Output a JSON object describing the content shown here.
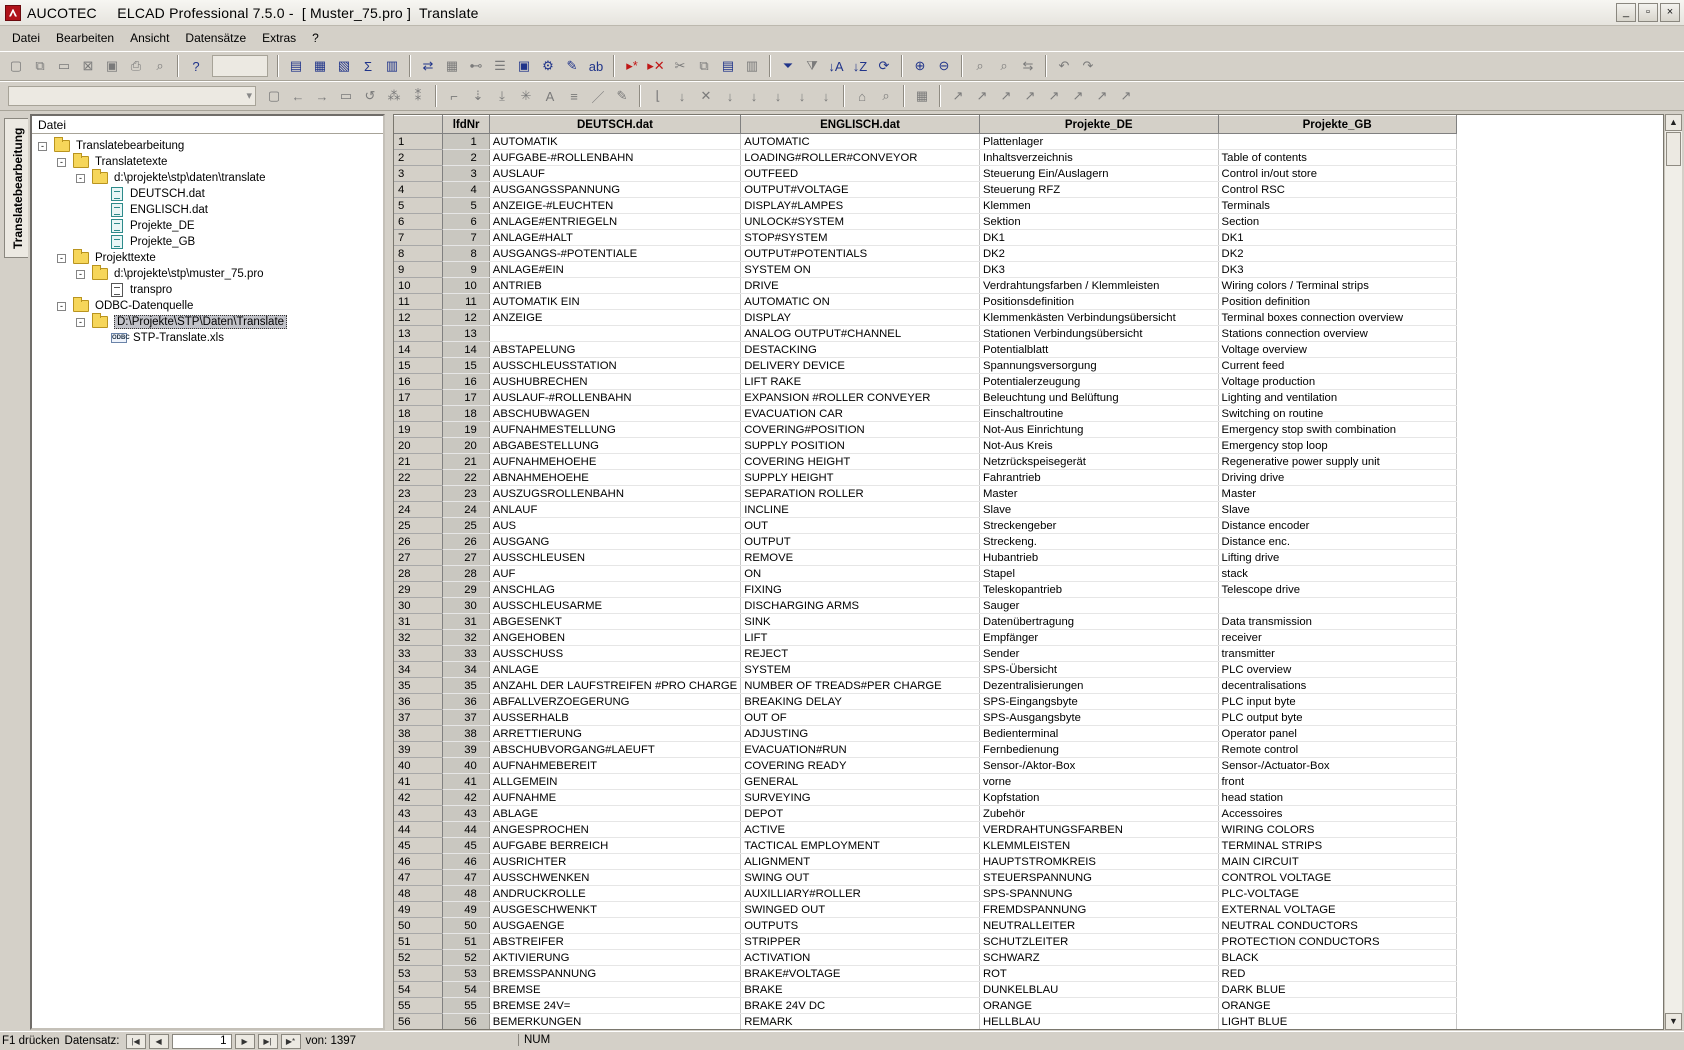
{
  "window": {
    "title": "AUCOTEC     ELCAD Professional 7.5.0 -  [ Muster_75.pro ]  Translate",
    "controls": [
      "_",
      "▫",
      "×"
    ]
  },
  "menu": [
    "Datei",
    "Bearbeiten",
    "Ansicht",
    "Datensätze",
    "Extras",
    "?"
  ],
  "side_tab": "Translatebearbeitung",
  "tree": {
    "header": "Datei",
    "nodes": [
      {
        "label": "Translatebearbeitung",
        "level": 0,
        "icon": "folder-icon",
        "expander": "-"
      },
      {
        "label": "Translatetexte",
        "level": 1,
        "icon": "folder-icon",
        "expander": "-"
      },
      {
        "label": "d:\\projekte\\stp\\daten\\translate",
        "level": 2,
        "icon": "folder-icon",
        "expander": "-"
      },
      {
        "label": "DEUTSCH.dat",
        "level": 3,
        "icon": "file-icon"
      },
      {
        "label": "ENGLISCH.dat",
        "level": 3,
        "icon": "file-icon"
      },
      {
        "label": "Projekte_DE",
        "level": 3,
        "icon": "file-icon"
      },
      {
        "label": "Projekte_GB",
        "level": 3,
        "icon": "file-icon"
      },
      {
        "label": "Projekttexte",
        "level": 1,
        "icon": "folder-icon",
        "expander": "-"
      },
      {
        "label": "d:\\projekte\\stp\\muster_75.pro",
        "level": 2,
        "icon": "folder-icon",
        "expander": "-"
      },
      {
        "label": "transpro",
        "level": 3,
        "icon": "doc-icon"
      },
      {
        "label": "ODBC-Datenquelle",
        "level": 1,
        "icon": "folder-icon",
        "expander": "-"
      },
      {
        "label": "D:\\Projekte\\STP\\Daten\\Translate",
        "level": 2,
        "icon": "folder-icon",
        "expander": "-",
        "selected": true
      },
      {
        "label": "STP-Translate.xls",
        "level": 3,
        "icon": "odbc-icon",
        "icon_text": "ODBC"
      }
    ]
  },
  "grid": {
    "columns": [
      "lfdNr",
      "DEUTSCH.dat",
      "ENGLISCH.dat",
      "Projekte_DE",
      "Projekte_GB"
    ],
    "rows": [
      [
        "1",
        "1",
        "AUTOMATIK",
        "AUTOMATIC",
        "Plattenlager",
        ""
      ],
      [
        "2",
        "2",
        "AUFGABE-#ROLLENBAHN",
        "LOADING#ROLLER#CONVEYOR",
        "Inhaltsverzeichnis",
        "Table of contents"
      ],
      [
        "3",
        "3",
        "AUSLAUF",
        "OUTFEED",
        "Steuerung Ein/Auslagern",
        "Control in/out store"
      ],
      [
        "4",
        "4",
        "AUSGANGSSPANNUNG",
        "OUTPUT#VOLTAGE",
        "Steuerung RFZ",
        "Control RSC"
      ],
      [
        "5",
        "5",
        "ANZEIGE-#LEUCHTEN",
        "DISPLAY#LAMPES",
        "Klemmen",
        "Terminals"
      ],
      [
        "6",
        "6",
        "ANLAGE#ENTRIEGELN",
        "UNLOCK#SYSTEM",
        "Sektion",
        "Section"
      ],
      [
        "7",
        "7",
        "ANLAGE#HALT",
        "STOP#SYSTEM",
        "DK1",
        "DK1"
      ],
      [
        "8",
        "8",
        "AUSGANGS-#POTENTIALE",
        "OUTPUT#POTENTIALS",
        "DK2",
        "DK2"
      ],
      [
        "9",
        "9",
        "ANLAGE#EIN",
        "SYSTEM ON",
        "DK3",
        "DK3"
      ],
      [
        "10",
        "10",
        "ANTRIEB",
        "DRIVE",
        "Verdrahtungsfarben / Klemmleisten",
        "Wiring colors / Terminal strips"
      ],
      [
        "11",
        "11",
        "AUTOMATIK EIN",
        "AUTOMATIC ON",
        "Positionsdefinition",
        "Position definition"
      ],
      [
        "12",
        "12",
        "ANZEIGE",
        "DISPLAY",
        "Klemmenkästen Verbindungsübersicht",
        "Terminal boxes connection overview"
      ],
      [
        "13",
        "13",
        "",
        "ANALOG OUTPUT#CHANNEL",
        "Stationen Verbindungsübersicht",
        "Stations connection overview"
      ],
      [
        "14",
        "14",
        "ABSTAPELUNG",
        "DESTACKING",
        "Potentialblatt",
        "Voltage overview"
      ],
      [
        "15",
        "15",
        "AUSSCHLEUSSTATION",
        "DELIVERY DEVICE",
        "Spannungsversorgung",
        "Current feed"
      ],
      [
        "16",
        "16",
        "AUSHUBRECHEN",
        "LIFT RAKE",
        "Potentialerzeugung",
        "Voltage production"
      ],
      [
        "17",
        "17",
        "AUSLAUF-#ROLLENBAHN",
        "EXPANSION #ROLLER CONVEYER",
        "Beleuchtung und Belüftung",
        "Lighting and ventilation"
      ],
      [
        "18",
        "18",
        "ABSCHUBWAGEN",
        "EVACUATION CAR",
        "Einschaltroutine",
        "Switching on routine"
      ],
      [
        "19",
        "19",
        "AUFNAHMESTELLUNG",
        "COVERING#POSITION",
        "Not-Aus Einrichtung",
        "Emergency stop swith combination"
      ],
      [
        "20",
        "20",
        "ABGABESTELLUNG",
        "SUPPLY POSITION",
        "Not-Aus Kreis",
        "Emergency stop loop"
      ],
      [
        "21",
        "21",
        "AUFNAHMEHOEHE",
        "COVERING HEIGHT",
        "Netzrückspeisegerät",
        "Regenerative power supply unit"
      ],
      [
        "22",
        "22",
        "ABNAHMEHOEHE",
        "SUPPLY HEIGHT",
        "Fahrantrieb",
        "Driving drive"
      ],
      [
        "23",
        "23",
        "AUSZUGSROLLENBAHN",
        "SEPARATION ROLLER",
        "Master",
        "Master"
      ],
      [
        "24",
        "24",
        "ANLAUF",
        "INCLINE",
        "Slave",
        "Slave"
      ],
      [
        "25",
        "25",
        "AUS",
        "OUT",
        "Streckengeber",
        "Distance encoder"
      ],
      [
        "26",
        "26",
        "AUSGANG",
        "OUTPUT",
        "Streckeng.",
        "Distance enc."
      ],
      [
        "27",
        "27",
        "AUSSCHLEUSEN",
        "REMOVE",
        "Hubantrieb",
        "Lifting drive"
      ],
      [
        "28",
        "28",
        "AUF",
        "ON",
        "Stapel",
        "stack"
      ],
      [
        "29",
        "29",
        "ANSCHLAG",
        "FIXING",
        "Teleskopantrieb",
        "Telescope drive"
      ],
      [
        "30",
        "30",
        "AUSSCHLEUSARME",
        "DISCHARGING ARMS",
        "Sauger",
        ""
      ],
      [
        "31",
        "31",
        "ABGESENKT",
        "SINK",
        "Datenübertragung",
        "Data transmission"
      ],
      [
        "32",
        "32",
        "ANGEHOBEN",
        "LIFT",
        "Empfänger",
        "receiver"
      ],
      [
        "33",
        "33",
        "AUSSCHUSS",
        "REJECT",
        "Sender",
        "transmitter"
      ],
      [
        "34",
        "34",
        "ANLAGE",
        "SYSTEM",
        "SPS-Übersicht",
        "PLC overview"
      ],
      [
        "35",
        "35",
        "ANZAHL DER LAUFSTREIFEN #PRO CHARGE",
        "NUMBER OF TREADS#PER CHARGE",
        "Dezentralisierungen",
        "decentralisations"
      ],
      [
        "36",
        "36",
        "ABFALLVERZOEGERUNG",
        "BREAKING DELAY",
        "SPS-Eingangsbyte",
        "PLC input byte"
      ],
      [
        "37",
        "37",
        "AUSSERHALB",
        "OUT OF",
        "SPS-Ausgangsbyte",
        "PLC output byte"
      ],
      [
        "38",
        "38",
        "ARRETTIERUNG",
        "ADJUSTING",
        "Bedienterminal",
        "Operator panel"
      ],
      [
        "39",
        "39",
        "ABSCHUBVORGANG#LAEUFT",
        "EVACUATION#RUN",
        "Fernbedienung",
        "Remote control"
      ],
      [
        "40",
        "40",
        "AUFNAHMEBEREIT",
        "COVERING READY",
        "Sensor-/Aktor-Box",
        "Sensor-/Actuator-Box"
      ],
      [
        "41",
        "41",
        "ALLGEMEIN",
        "GENERAL",
        "vorne",
        "front"
      ],
      [
        "42",
        "42",
        "AUFNAHME",
        "SURVEYING",
        "Kopfstation",
        "head station"
      ],
      [
        "43",
        "43",
        "ABLAGE",
        "DEPOT",
        "Zubehör",
        "Accessoires"
      ],
      [
        "44",
        "44",
        "ANGESPROCHEN",
        "ACTIVE",
        "VERDRAHTUNGSFARBEN",
        "WIRING COLORS"
      ],
      [
        "45",
        "45",
        "AUFGABE BERREICH",
        "TACTICAL EMPLOYMENT",
        "KLEMMLEISTEN",
        "TERMINAL STRIPS"
      ],
      [
        "46",
        "46",
        "AUSRICHTER",
        "ALIGNMENT",
        "HAUPTSTROMKREIS",
        "MAIN CIRCUIT"
      ],
      [
        "47",
        "47",
        "AUSSCHWENKEN",
        "SWING OUT",
        "STEUERSPANNUNG",
        "CONTROL VOLTAGE"
      ],
      [
        "48",
        "48",
        "ANDRUCKROLLE",
        "AUXILLIARY#ROLLER",
        "SPS-SPANNUNG",
        "PLC-VOLTAGE"
      ],
      [
        "49",
        "49",
        "AUSGESCHWENKT",
        "SWINGED OUT",
        "FREMDSPANNUNG",
        "EXTERNAL VOLTAGE"
      ],
      [
        "50",
        "50",
        "AUSGAENGE",
        "OUTPUTS",
        "NEUTRALLEITER",
        "NEUTRAL CONDUCTORS"
      ],
      [
        "51",
        "51",
        "ABSTREIFER",
        "STRIPPER",
        "SCHUTZLEITER",
        "PROTECTION CONDUCTORS"
      ],
      [
        "52",
        "52",
        "AKTIVIERUNG",
        "ACTIVATION",
        "SCHWARZ",
        "BLACK"
      ],
      [
        "53",
        "53",
        "BREMSSPANNUNG",
        "BRAKE#VOLTAGE",
        "ROT",
        "RED"
      ],
      [
        "54",
        "54",
        "BREMSE",
        "BRAKE",
        "DUNKELBLAU",
        "DARK BLUE"
      ],
      [
        "55",
        "55",
        "BREMSE 24V=",
        "BRAKE 24V DC",
        "ORANGE",
        "ORANGE"
      ],
      [
        "56",
        "56",
        "BEMERKUNGEN",
        "REMARK",
        "HELLBLAU",
        "LIGHT BLUE"
      ]
    ]
  },
  "status": {
    "hint": "F1 drücken",
    "record_label": "Datensatz:",
    "nav_first": "|◀",
    "nav_prev": "◀",
    "current_record": "1",
    "nav_next": "▶",
    "nav_last": "▶|",
    "nav_new": "▶*",
    "count": "von: 1397",
    "num_indicator": "NUM"
  },
  "colors": {
    "selected_row_header": "#d4d0c8",
    "grid_lines": "#c8c8c8",
    "tree_selection": "#c2c3c9"
  }
}
